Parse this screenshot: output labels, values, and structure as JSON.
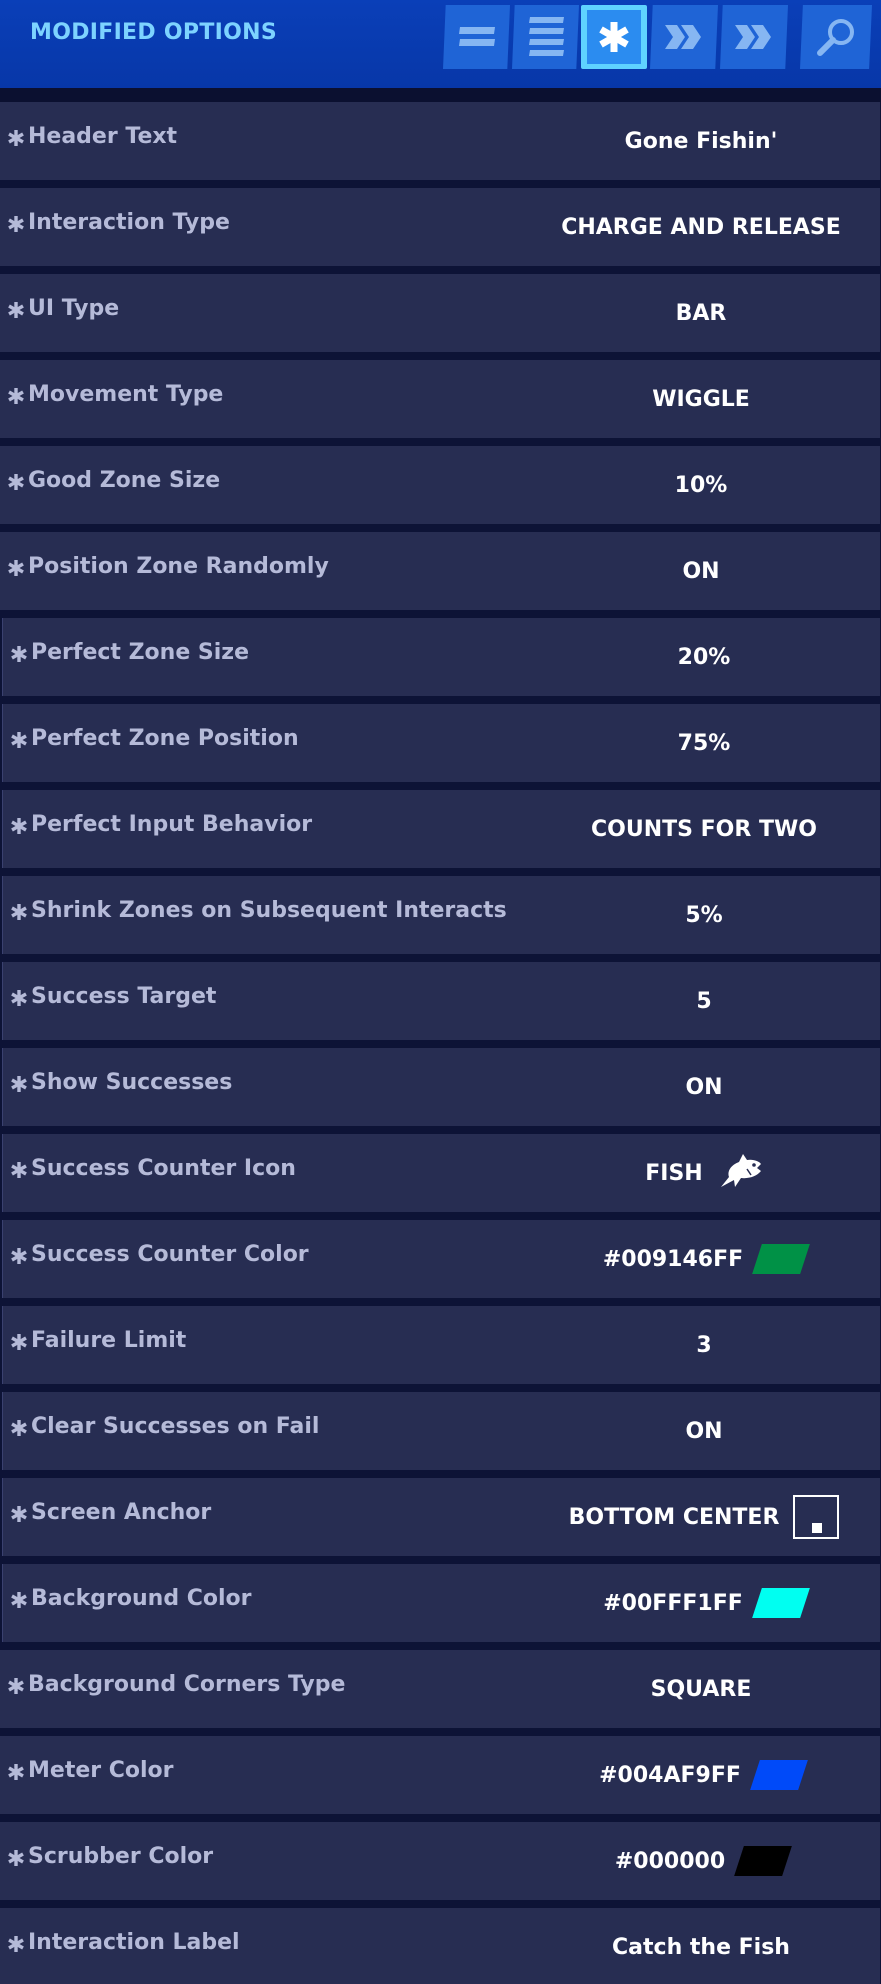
{
  "header": {
    "title": "MODIFIED OPTIONS",
    "tabs": [
      {
        "icon": "two-bars-icon"
      },
      {
        "icon": "list-icon"
      },
      {
        "icon": "asterisk-icon",
        "active": true
      },
      {
        "icon": "double-chevron-icon"
      },
      {
        "icon": "double-chevron-icon"
      },
      {
        "icon": "search-icon"
      }
    ]
  },
  "rows": [
    {
      "label": "Header Text",
      "value": "Gone Fishin'"
    },
    {
      "label": "Interaction Type",
      "value": "CHARGE AND RELEASE"
    },
    {
      "label": "UI Type",
      "value": "BAR"
    },
    {
      "label": "Movement Type",
      "value": "WIGGLE"
    },
    {
      "label": "Good Zone Size",
      "value": "10%"
    },
    {
      "label": "Position Zone Randomly",
      "value": "ON"
    },
    {
      "label": "Perfect Zone Size",
      "value": "20%"
    },
    {
      "label": "Perfect Zone Position",
      "value": "75%"
    },
    {
      "label": "Perfect Input Behavior",
      "value": "COUNTS FOR TWO"
    },
    {
      "label": "Shrink Zones on Subsequent Interacts",
      "value": "5%"
    },
    {
      "label": "Success Target",
      "value": "5"
    },
    {
      "label": "Show Successes",
      "value": "ON"
    },
    {
      "label": "Success Counter Icon",
      "value": "FISH",
      "icon": "fish-icon"
    },
    {
      "label": "Success Counter Color",
      "value": "#009146FF",
      "swatch": "#009146"
    },
    {
      "label": "Failure Limit",
      "value": "3"
    },
    {
      "label": "Clear Successes on Fail",
      "value": "ON"
    },
    {
      "label": "Screen Anchor",
      "value": "BOTTOM CENTER",
      "icon": "screen-anchor-icon"
    },
    {
      "label": "Background Color",
      "value": "#00FFF1FF",
      "swatch": "#00FFF1"
    },
    {
      "label": "Background Corners Type",
      "value": "SQUARE"
    },
    {
      "label": "Meter Color",
      "value": "#004AF9FF",
      "swatch": "#004AF9"
    },
    {
      "label": "Scrubber Color",
      "value": "#000000",
      "swatch": "#000000"
    },
    {
      "label": "Interaction Label",
      "value": "Catch the Fish"
    }
  ],
  "colors": {
    "header_bg": "#0737a8",
    "title": "#7dd3ff",
    "row_bg": "#272d52",
    "label": "#b5bad8",
    "value": "#ffffff"
  }
}
